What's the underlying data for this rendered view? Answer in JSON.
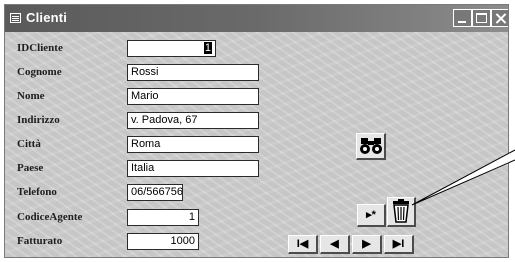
{
  "window": {
    "title": "Clienti"
  },
  "fields": [
    {
      "label": "IDCliente",
      "value": "1"
    },
    {
      "label": "Cognome",
      "value": "Rossi"
    },
    {
      "label": "Nome",
      "value": "Mario"
    },
    {
      "label": "Indirizzo",
      "value": "v. Padova, 67"
    },
    {
      "label": "Città",
      "value": "Roma"
    },
    {
      "label": "Paese",
      "value": "Italia"
    },
    {
      "label": "Telefono",
      "value": "06/566756"
    },
    {
      "label": "CodiceAgente",
      "value": "1"
    },
    {
      "label": "Fatturato",
      "value": "1000"
    }
  ],
  "buttons": {
    "new_record": "▸*",
    "first": "I◀",
    "prev": "◀",
    "next": "▶",
    "last": "▶I"
  },
  "icons": {
    "title": "form-icon",
    "find": "binoculars-icon",
    "delete": "trash-icon"
  }
}
